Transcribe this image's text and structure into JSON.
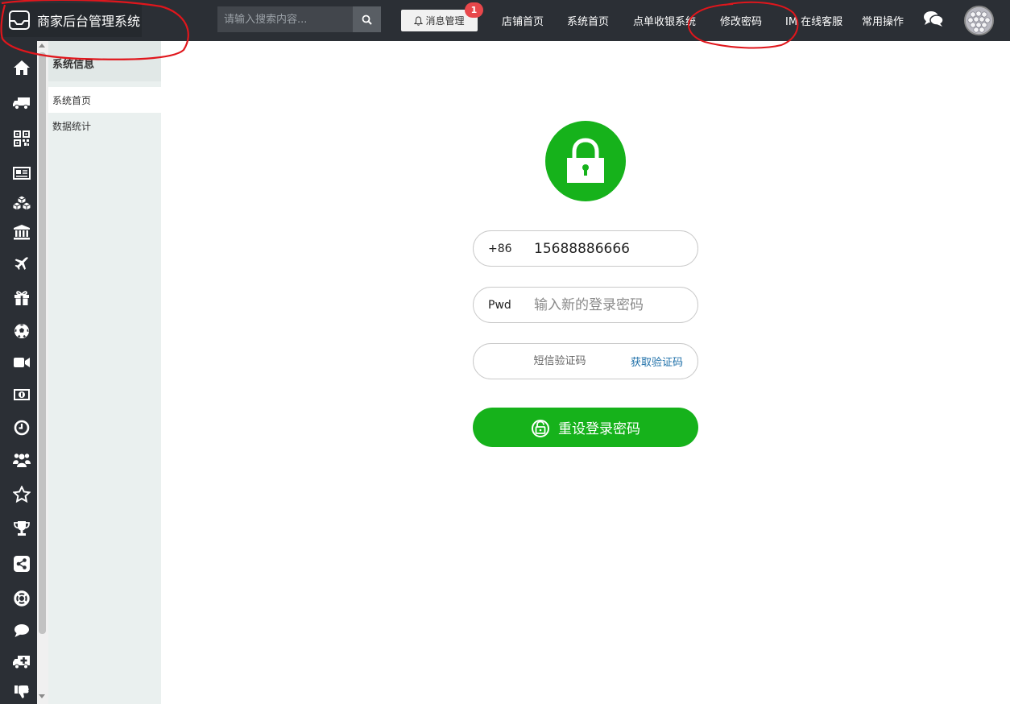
{
  "header": {
    "brand_title": "商家后台管理系统",
    "search_placeholder": "请输入搜索内容...",
    "message_button": "消息管理",
    "message_badge": "1",
    "nav": [
      {
        "label": "店铺首页"
      },
      {
        "label": "系统首页"
      },
      {
        "label": "点单收银系统"
      },
      {
        "label": "修改密码"
      },
      {
        "label": "IM 在线客服"
      },
      {
        "label": "常用操作"
      }
    ]
  },
  "sidebar_icons": [
    "home-icon",
    "truck-icon",
    "qrcode-icon",
    "newspaper-icon",
    "cubes-icon",
    "bank-icon",
    "plane-icon",
    "gift-icon",
    "soccer-ball-icon",
    "video-camera-icon",
    "money-icon",
    "clock-icon",
    "users-icon",
    "star-icon",
    "trophy-icon",
    "share-icon",
    "life-ring-icon",
    "comment-icon",
    "ambulance-icon",
    "thumbs-down-icon"
  ],
  "submenu": {
    "title": "系统信息",
    "items": [
      {
        "label": "系统首页",
        "active": true
      },
      {
        "label": "数据统计",
        "active": false
      }
    ]
  },
  "form": {
    "phone_prefix": "+86",
    "phone_value": "15688886666",
    "pwd_prefix": "Pwd",
    "pwd_placeholder": "输入新的登录密码",
    "sms_placeholder": "短信验证码",
    "sms_link": "获取验证码",
    "submit_label": "重设登录密码"
  },
  "colors": {
    "topbar": "#2b2f35",
    "accent_green": "#16b21b",
    "badge_red": "#e8474b",
    "link_blue": "#1d6fa8",
    "annotation_red": "#e0161c"
  }
}
